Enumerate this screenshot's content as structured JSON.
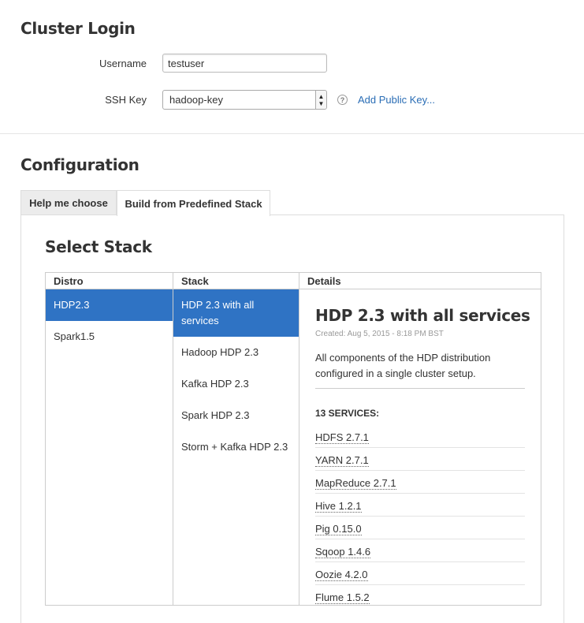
{
  "cluster_login": {
    "title": "Cluster Login",
    "username_label": "Username",
    "username_value": "testuser",
    "ssh_key_label": "SSH Key",
    "ssh_key_selected": "hadoop-key",
    "help_glyph": "?",
    "add_key_link": "Add Public Key..."
  },
  "configuration": {
    "title": "Configuration",
    "tabs": [
      {
        "label": "Help me choose",
        "active": false
      },
      {
        "label": "Build from Predefined Stack",
        "active": true
      }
    ],
    "select_stack_title": "Select Stack",
    "columns": {
      "distro": "Distro",
      "stack": "Stack",
      "details": "Details"
    },
    "distros": [
      {
        "label": "HDP2.3",
        "selected": true
      },
      {
        "label": "Spark1.5",
        "selected": false
      }
    ],
    "stacks": [
      {
        "label": "HDP 2.3 with all services",
        "selected": true
      },
      {
        "label": "Hadoop HDP 2.3",
        "selected": false
      },
      {
        "label": "Kafka HDP 2.3",
        "selected": false
      },
      {
        "label": "Spark HDP 2.3",
        "selected": false
      },
      {
        "label": "Storm + Kafka HDP 2.3",
        "selected": false
      }
    ],
    "details": {
      "title": "HDP 2.3 with all services",
      "created": "Created: Aug 5, 2015 - 8:18 PM BST",
      "description": "All components of the HDP distribution configured in a single cluster setup.",
      "services_heading": "13 SERVICES:",
      "services": [
        "HDFS 2.7.1",
        "YARN 2.7.1",
        "MapReduce 2.7.1",
        "Hive 1.2.1",
        "Pig 0.15.0",
        "Sqoop 1.4.6",
        "Oozie 4.2.0",
        "Flume 1.5.2"
      ]
    }
  },
  "colors": {
    "selected_bg": "#2f73c4",
    "link": "#2a6db5"
  }
}
